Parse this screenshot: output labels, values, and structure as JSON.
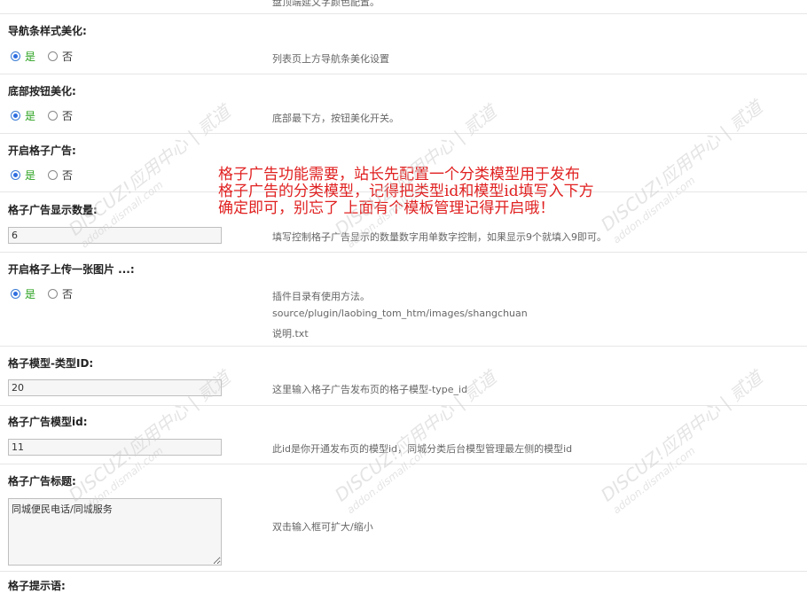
{
  "top_cut_text": "盘顶端延文字颜色配置。",
  "settings": [
    {
      "label": "导航条样式美化:",
      "type": "radio",
      "yes": "是",
      "no": "否",
      "desc": "列表页上方导航条美化设置"
    },
    {
      "label": "底部按钮美化:",
      "type": "radio",
      "yes": "是",
      "no": "否",
      "desc": "底部最下方，按钮美化开关。"
    },
    {
      "label": "开启格子广告:",
      "type": "radio",
      "yes": "是",
      "no": "否",
      "desc": ""
    },
    {
      "label": "格子广告显示数量:",
      "type": "input",
      "value": "6",
      "desc": "填写控制格子广告显示的数量数字用单数字控制，如果显示9个就填入9即可。"
    },
    {
      "label": "开启格子上传一张图片 ...:",
      "type": "radio",
      "yes": "是",
      "no": "否",
      "desc_lines": [
        "插件目录有使用方法。",
        "source/plugin/laobing_tom_htm/images/shangchuan",
        "说明.txt"
      ]
    },
    {
      "label": "格子模型-类型ID:",
      "type": "input",
      "value": "20",
      "desc": "这里输入格子广告发布页的格子模型-type_id"
    },
    {
      "label": "格子广告模型id:",
      "type": "input",
      "value": "11",
      "desc": "此id是你开通发布页的模型id，同城分类后台模型管理最左侧的模型id"
    },
    {
      "label": "格子广告标题:",
      "type": "textarea",
      "value": "同城便民电话/同城服务",
      "desc": "双击输入框可扩大/缩小"
    },
    {
      "label": "格子提示语:"
    }
  ],
  "annotation_lines": [
    "格子广告功能需要，站长先配置一个分类模型用于发布",
    "格子广告的分类模型，记得把类型id和模型id填写入下方",
    "确定即可，别忘了 上面有个模板管理记得开启哦！"
  ],
  "watermark": {
    "text": "DISCUZ!应用中心 | 贰道",
    "sub": "addon.dismall.com"
  }
}
